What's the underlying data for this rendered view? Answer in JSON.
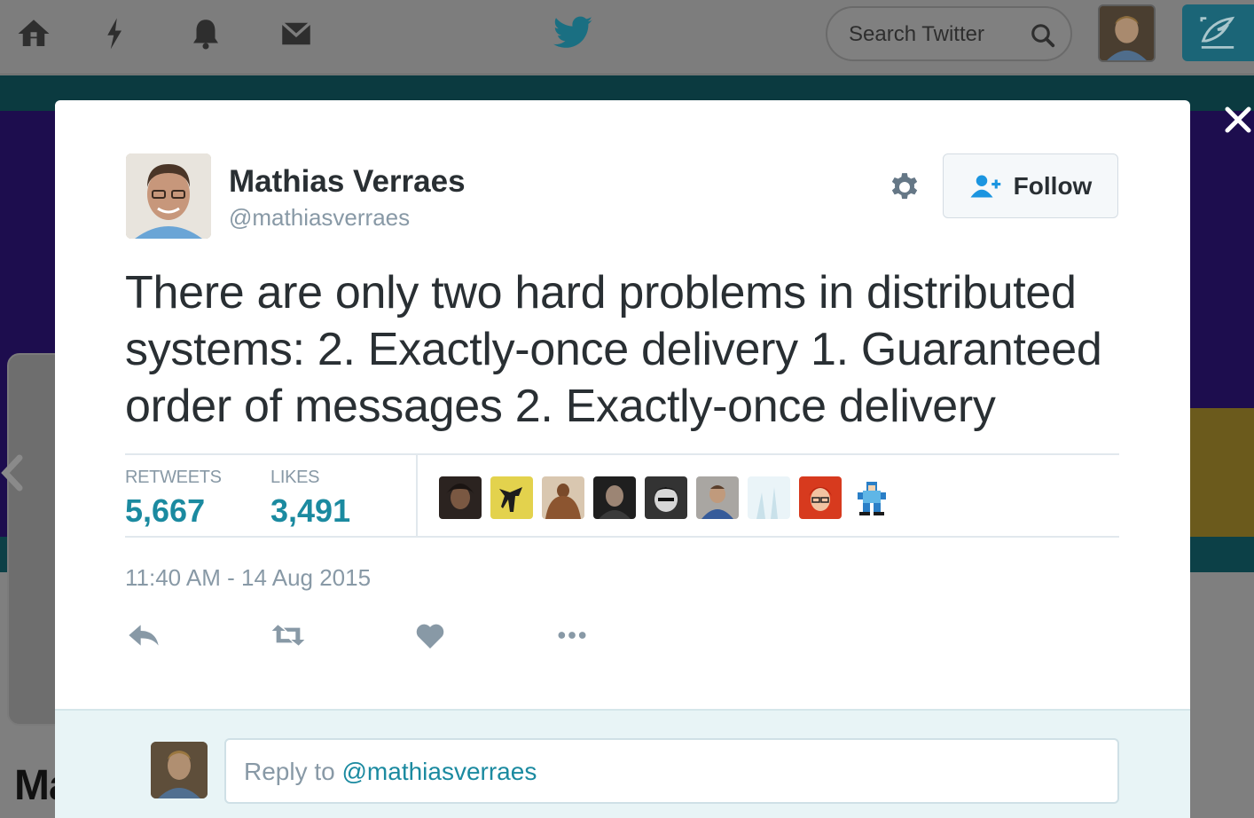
{
  "topbar": {
    "icons": [
      "home-icon",
      "moments-icon",
      "notifications-icon",
      "messages-icon"
    ],
    "logo": "twitter-bird-icon",
    "search_placeholder": "Search Twitter",
    "search_icon": "search-icon",
    "compose_icon": "compose-tweet-icon"
  },
  "background_page": {
    "partial_name": "Ma"
  },
  "modal": {
    "close_icon": "close-icon",
    "author": {
      "name": "Mathias Verraes",
      "handle": "@mathiasverraes"
    },
    "gear_icon": "gear-icon",
    "follow_label": "Follow",
    "tweet_text": "There are only two hard problems in distributed systems:  2. Exactly-once delivery 1. Guaranteed order of messages 2. Exactly-once delivery",
    "stats": {
      "retweets_label": "RETWEETS",
      "retweets_value": "5,667",
      "likes_label": "LIKES",
      "likes_value": "3,491"
    },
    "likers_count_shown": 9,
    "timestamp": "11:40 AM - 14 Aug 2015",
    "actions": [
      "reply-icon",
      "retweet-icon",
      "like-icon",
      "more-icon"
    ],
    "reply": {
      "prefix": "Reply to ",
      "handle": "@mathiasverraes"
    }
  },
  "colors": {
    "accent": "#1b8aa0",
    "muted_text": "#8899a6",
    "primary_text": "#292f33"
  }
}
